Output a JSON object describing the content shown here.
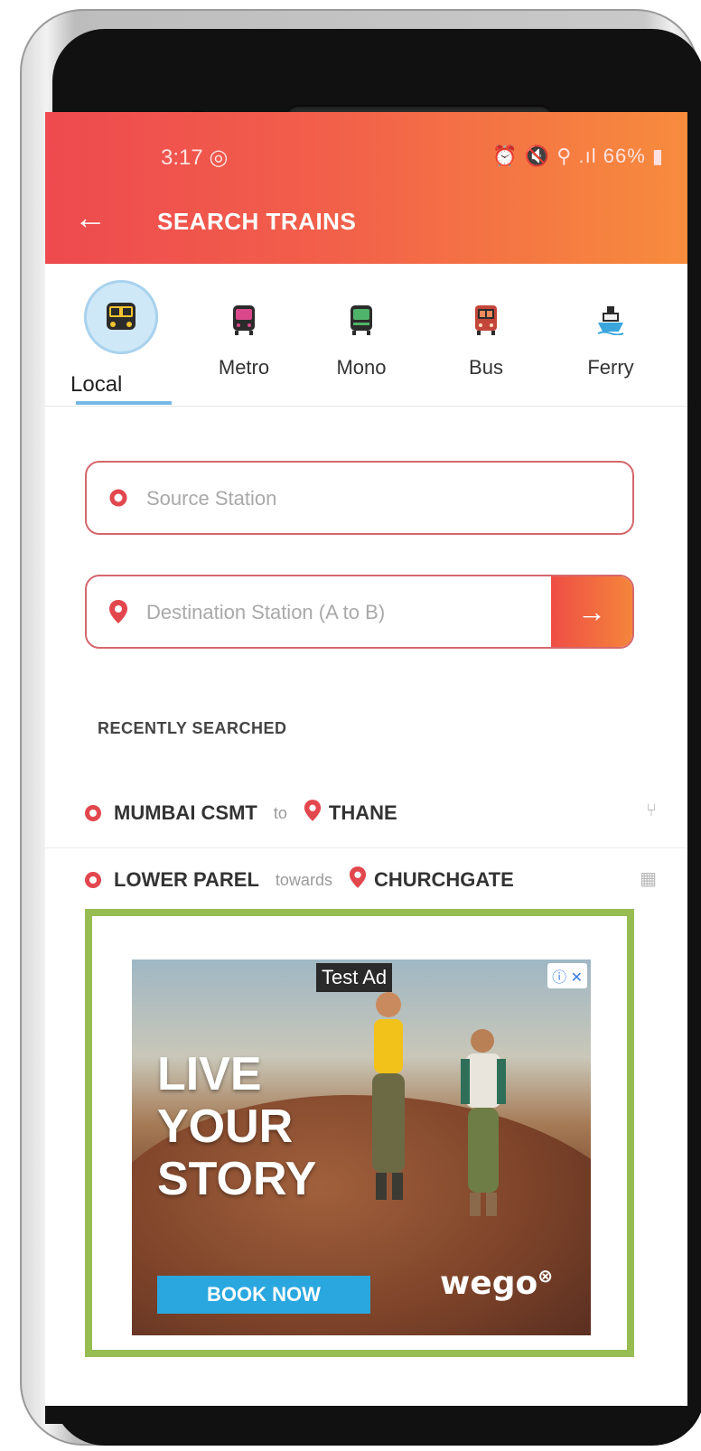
{
  "status_bar": {
    "time": "3:17 ◎",
    "indicators": "⏰ 🔇 📍 Wi-Fi .ıl 66%",
    "battery": "66%"
  },
  "app_bar": {
    "back_icon": "arrow-left-icon",
    "title": "SEARCH TRAINS"
  },
  "tabs": [
    {
      "label": "Local",
      "icon": "local-train-icon",
      "active": true
    },
    {
      "label": "Metro",
      "icon": "metro-train-icon",
      "active": false
    },
    {
      "label": "Mono",
      "icon": "monorail-icon",
      "active": false
    },
    {
      "label": "Bus",
      "icon": "bus-icon",
      "active": false
    },
    {
      "label": "Ferry",
      "icon": "ferry-icon",
      "active": false
    }
  ],
  "search": {
    "source_placeholder": "Source Station",
    "destination_placeholder": "Destination Station (A to B)",
    "go_icon": "arrow-right-icon"
  },
  "recent": {
    "title": "RECENTLY  SEARCHED",
    "items": [
      {
        "from": "MUMBAI CSMT",
        "connector": "to",
        "to": "THANE",
        "icon": "route-fork-icon"
      },
      {
        "from": "LOWER PAREL",
        "connector": "towards",
        "to": "CHURCHGATE",
        "icon": "train-direction-icon"
      }
    ]
  },
  "ad": {
    "tag": "Test Ad",
    "close": "ⓘ ✕",
    "headline_lines": [
      "LIVE",
      "YOUR",
      "STORY"
    ],
    "cta": "BOOK NOW",
    "brand": "wego"
  },
  "colors": {
    "accent_red": "#ee4a4f",
    "accent_orange": "#f78c3d",
    "ad_border": "#97bd52",
    "active_tab_bg": "#cfe8f7"
  }
}
